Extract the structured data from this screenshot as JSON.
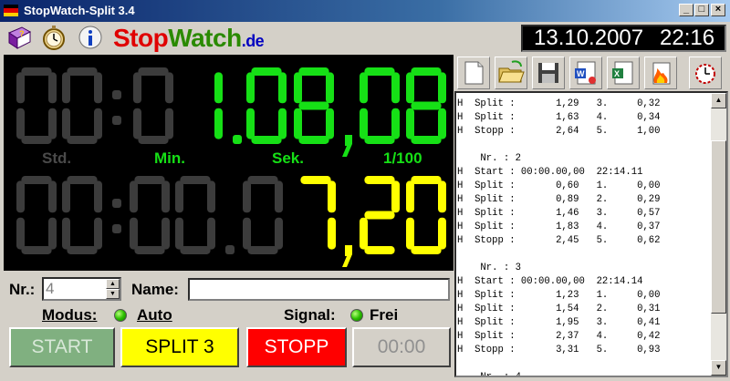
{
  "window": {
    "title": "StopWatch-Split 3.4",
    "min_label": "_",
    "max_label": "□",
    "close_label": "×"
  },
  "header": {
    "logo_part1": "Stop",
    "logo_part2": "Watch",
    "logo_part3": ".de",
    "date": "13.10.2007",
    "time": "22:16"
  },
  "clock": {
    "main_hours": "00",
    "main_minutes": "0",
    "main_seconds": "1.08",
    "main_hundredths": "08",
    "label_hours": "Std.",
    "label_minutes": "Min.",
    "label_seconds": "Sek.",
    "label_hundredths": "1/100",
    "split_left": "00:00.0",
    "split_right": "7,20",
    "dim_color": "#3c3c3c",
    "green_color": "#16e016",
    "yellow_color": "#ffff00"
  },
  "toolbar": {
    "icons": [
      "new-document-icon",
      "open-folder-icon",
      "save-disk-icon",
      "word-export-icon",
      "excel-export-icon",
      "delete-fire-icon",
      "alarm-clock-icon"
    ]
  },
  "log": {
    "lines": [
      "H  Split :       1,29   3.     0,32",
      "H  Split :       1,63   4.     0,34",
      "H  Stopp :       2,64   5.     1,00",
      "",
      "    Nr. : 2",
      "H  Start : 00:00.00,00  22:14.11",
      "H  Split :       0,60   1.     0,00",
      "H  Split :       0,89   2.     0,29",
      "H  Split :       1,46   3.     0,57",
      "H  Split :       1,83   4.     0,37",
      "H  Stopp :       2,45   5.     0,62",
      "",
      "    Nr. : 3",
      "H  Start : 00:00.00,00  22:14.14",
      "H  Split :       1,23   1.     0,00",
      "H  Split :       1,54   2.     0,31",
      "H  Split :       1,95   3.     0,41",
      "H  Split :       2,37   4.     0,42",
      "H  Stopp :       3,31   5.     0,93",
      "",
      "    Nr. : 4"
    ]
  },
  "controls": {
    "nr_label": "Nr.:",
    "nr_value": "4",
    "name_label": "Name:",
    "name_value": "",
    "modus_label": "Modus:",
    "modus_value": "Auto",
    "signal_label": "Signal:",
    "signal_value": "Frei",
    "start_label": "START",
    "split_label": "SPLIT 3",
    "stopp_label": "STOPP",
    "reset_label": "00:00"
  }
}
